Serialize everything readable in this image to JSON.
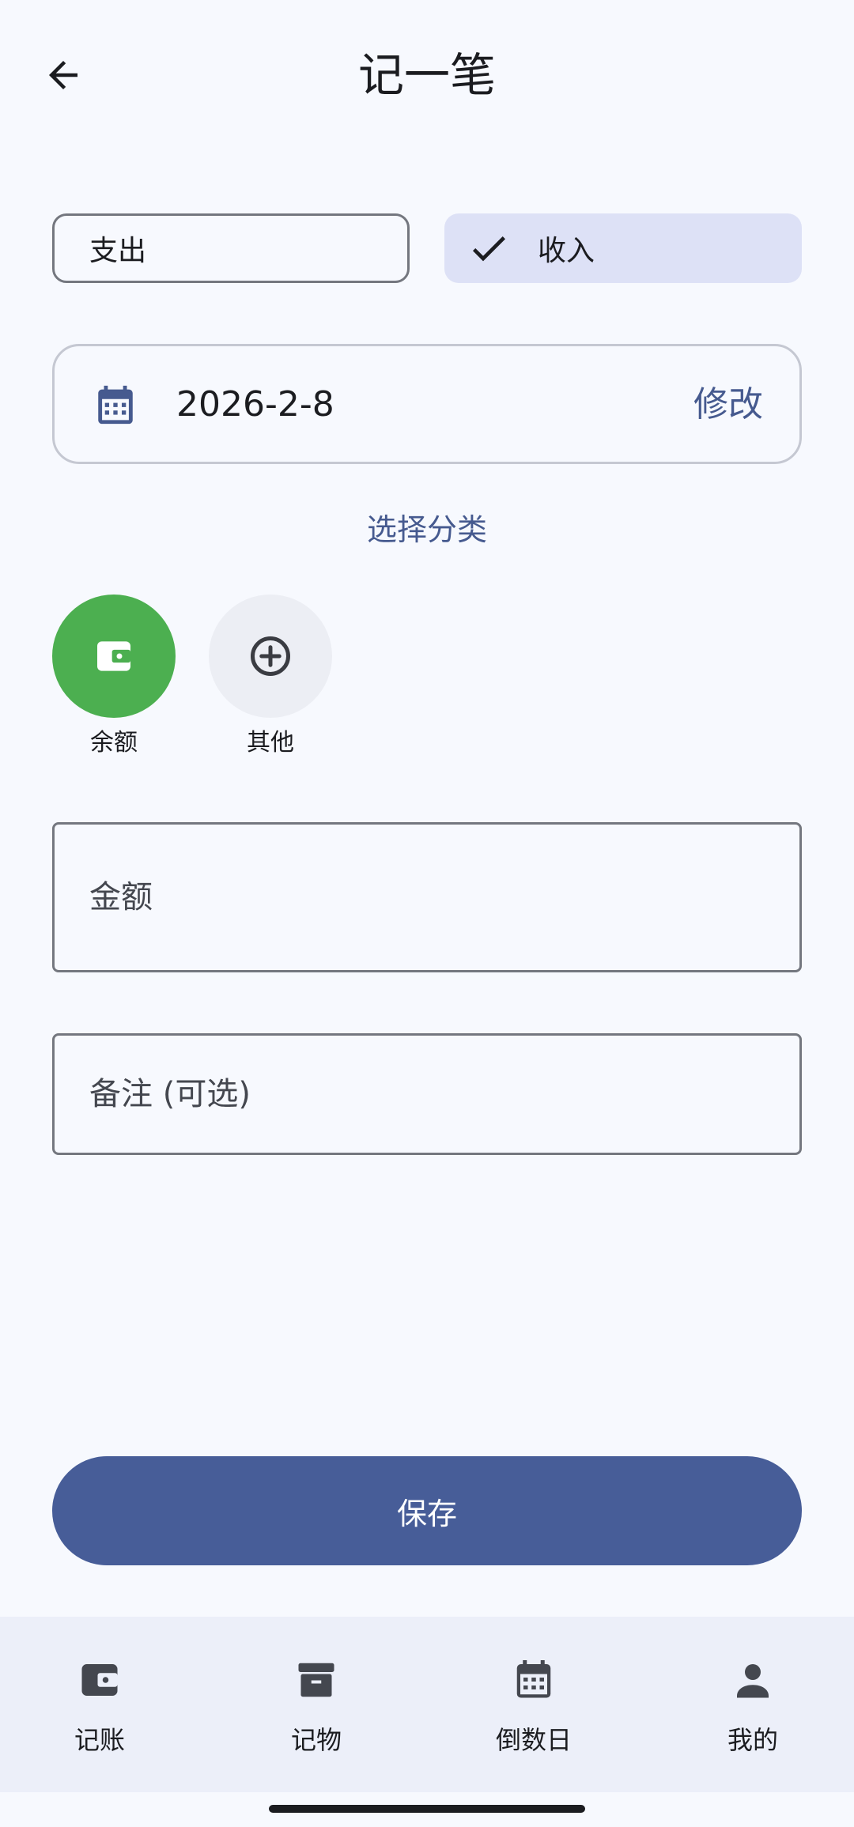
{
  "header": {
    "title": "记一笔"
  },
  "type_toggle": {
    "expense_label": "支出",
    "income_label": "收入",
    "selected": "收入"
  },
  "date": {
    "value": "2026-2-8",
    "edit_label": "修改"
  },
  "category": {
    "title": "选择分类",
    "items": [
      {
        "label": "余额",
        "icon": "wallet-icon",
        "selected": true,
        "color": "#4caf50"
      },
      {
        "label": "其他",
        "icon": "add-circle-icon",
        "selected": false
      }
    ]
  },
  "form": {
    "amount": {
      "placeholder": "金额",
      "value": ""
    },
    "note": {
      "placeholder": "备注 (可选)",
      "value": ""
    }
  },
  "save_button": {
    "label": "保存",
    "color": "#475d98"
  },
  "bottom_nav": {
    "items": [
      {
        "label": "记账",
        "icon": "wallet-icon"
      },
      {
        "label": "记物",
        "icon": "archive-box-icon"
      },
      {
        "label": "倒数日",
        "icon": "calendar-icon"
      },
      {
        "label": "我的",
        "icon": "person-icon"
      }
    ]
  }
}
